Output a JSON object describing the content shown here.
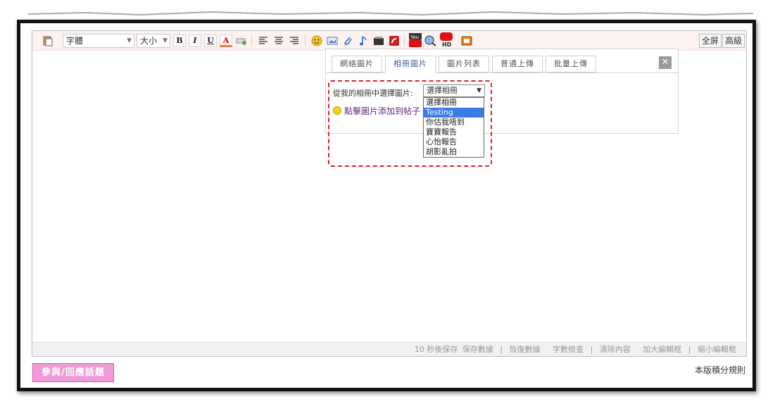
{
  "toolbar": {
    "font_label": "字體",
    "size_label": "大小",
    "bold": "B",
    "italic": "I",
    "underline": "U",
    "color": "A",
    "fullscreen": "全屏",
    "advanced": "高級",
    "youtube": "You",
    "youtube_hd": "HD"
  },
  "popup": {
    "tabs": [
      "網絡圖片",
      "相冊圖片",
      "圖片列表",
      "普通上傳",
      "批量上傳"
    ],
    "active_tab": "相冊圖片",
    "close": "✕",
    "pick_label": "從我的相冊中選擇圖片:",
    "hint": "點擊圖片添加到帖子",
    "select_value": "選擇相冊",
    "options": [
      "選擇相冊",
      "Testing",
      "你估我唔到",
      "寶寶報告",
      "心怡報告",
      "胡影亂拍"
    ],
    "highlighted_option": "Testing"
  },
  "status": {
    "autosave": "10 秒後保存",
    "save": "保存數據",
    "restore": "恢復數據",
    "wordcheck": "字數檢查",
    "clear": "清除內容",
    "enlarge": "加大編輯框",
    "shrink": "縮小編輯框",
    "sep": "|"
  },
  "footer": {
    "reply_button": "參與/回應話題",
    "rules_link": "本版積分規則"
  },
  "colors": {
    "accent_pink": "#f09ad9",
    "highlight_blue": "#3a7be6",
    "dash_red": "#e1202a"
  }
}
